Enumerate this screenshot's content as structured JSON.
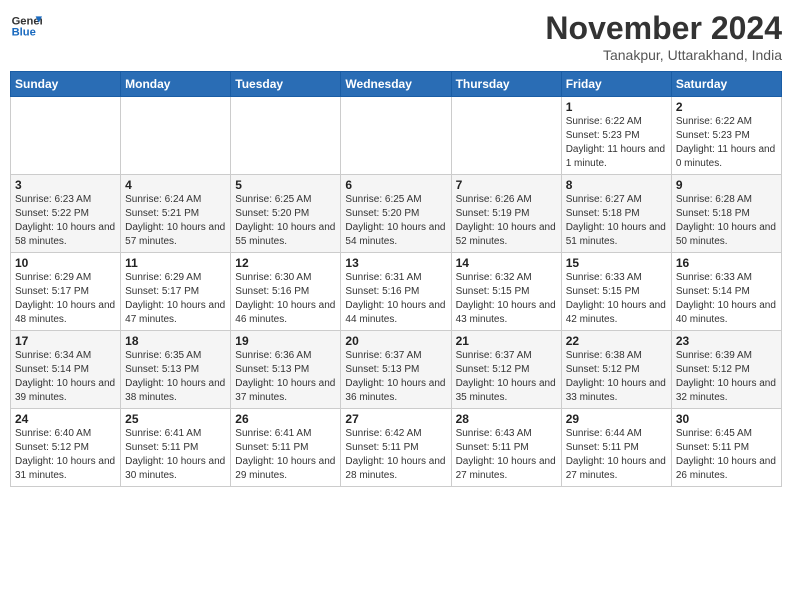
{
  "logo": {
    "line1": "General",
    "line2": "Blue"
  },
  "title": "November 2024",
  "location": "Tanakpur, Uttarakhand, India",
  "days_of_week": [
    "Sunday",
    "Monday",
    "Tuesday",
    "Wednesday",
    "Thursday",
    "Friday",
    "Saturday"
  ],
  "weeks": [
    [
      {
        "day": "",
        "info": ""
      },
      {
        "day": "",
        "info": ""
      },
      {
        "day": "",
        "info": ""
      },
      {
        "day": "",
        "info": ""
      },
      {
        "day": "",
        "info": ""
      },
      {
        "day": "1",
        "info": "Sunrise: 6:22 AM\nSunset: 5:23 PM\nDaylight: 11 hours and 1 minute."
      },
      {
        "day": "2",
        "info": "Sunrise: 6:22 AM\nSunset: 5:23 PM\nDaylight: 11 hours and 0 minutes."
      }
    ],
    [
      {
        "day": "3",
        "info": "Sunrise: 6:23 AM\nSunset: 5:22 PM\nDaylight: 10 hours and 58 minutes."
      },
      {
        "day": "4",
        "info": "Sunrise: 6:24 AM\nSunset: 5:21 PM\nDaylight: 10 hours and 57 minutes."
      },
      {
        "day": "5",
        "info": "Sunrise: 6:25 AM\nSunset: 5:20 PM\nDaylight: 10 hours and 55 minutes."
      },
      {
        "day": "6",
        "info": "Sunrise: 6:25 AM\nSunset: 5:20 PM\nDaylight: 10 hours and 54 minutes."
      },
      {
        "day": "7",
        "info": "Sunrise: 6:26 AM\nSunset: 5:19 PM\nDaylight: 10 hours and 52 minutes."
      },
      {
        "day": "8",
        "info": "Sunrise: 6:27 AM\nSunset: 5:18 PM\nDaylight: 10 hours and 51 minutes."
      },
      {
        "day": "9",
        "info": "Sunrise: 6:28 AM\nSunset: 5:18 PM\nDaylight: 10 hours and 50 minutes."
      }
    ],
    [
      {
        "day": "10",
        "info": "Sunrise: 6:29 AM\nSunset: 5:17 PM\nDaylight: 10 hours and 48 minutes."
      },
      {
        "day": "11",
        "info": "Sunrise: 6:29 AM\nSunset: 5:17 PM\nDaylight: 10 hours and 47 minutes."
      },
      {
        "day": "12",
        "info": "Sunrise: 6:30 AM\nSunset: 5:16 PM\nDaylight: 10 hours and 46 minutes."
      },
      {
        "day": "13",
        "info": "Sunrise: 6:31 AM\nSunset: 5:16 PM\nDaylight: 10 hours and 44 minutes."
      },
      {
        "day": "14",
        "info": "Sunrise: 6:32 AM\nSunset: 5:15 PM\nDaylight: 10 hours and 43 minutes."
      },
      {
        "day": "15",
        "info": "Sunrise: 6:33 AM\nSunset: 5:15 PM\nDaylight: 10 hours and 42 minutes."
      },
      {
        "day": "16",
        "info": "Sunrise: 6:33 AM\nSunset: 5:14 PM\nDaylight: 10 hours and 40 minutes."
      }
    ],
    [
      {
        "day": "17",
        "info": "Sunrise: 6:34 AM\nSunset: 5:14 PM\nDaylight: 10 hours and 39 minutes."
      },
      {
        "day": "18",
        "info": "Sunrise: 6:35 AM\nSunset: 5:13 PM\nDaylight: 10 hours and 38 minutes."
      },
      {
        "day": "19",
        "info": "Sunrise: 6:36 AM\nSunset: 5:13 PM\nDaylight: 10 hours and 37 minutes."
      },
      {
        "day": "20",
        "info": "Sunrise: 6:37 AM\nSunset: 5:13 PM\nDaylight: 10 hours and 36 minutes."
      },
      {
        "day": "21",
        "info": "Sunrise: 6:37 AM\nSunset: 5:12 PM\nDaylight: 10 hours and 35 minutes."
      },
      {
        "day": "22",
        "info": "Sunrise: 6:38 AM\nSunset: 5:12 PM\nDaylight: 10 hours and 33 minutes."
      },
      {
        "day": "23",
        "info": "Sunrise: 6:39 AM\nSunset: 5:12 PM\nDaylight: 10 hours and 32 minutes."
      }
    ],
    [
      {
        "day": "24",
        "info": "Sunrise: 6:40 AM\nSunset: 5:12 PM\nDaylight: 10 hours and 31 minutes."
      },
      {
        "day": "25",
        "info": "Sunrise: 6:41 AM\nSunset: 5:11 PM\nDaylight: 10 hours and 30 minutes."
      },
      {
        "day": "26",
        "info": "Sunrise: 6:41 AM\nSunset: 5:11 PM\nDaylight: 10 hours and 29 minutes."
      },
      {
        "day": "27",
        "info": "Sunrise: 6:42 AM\nSunset: 5:11 PM\nDaylight: 10 hours and 28 minutes."
      },
      {
        "day": "28",
        "info": "Sunrise: 6:43 AM\nSunset: 5:11 PM\nDaylight: 10 hours and 27 minutes."
      },
      {
        "day": "29",
        "info": "Sunrise: 6:44 AM\nSunset: 5:11 PM\nDaylight: 10 hours and 27 minutes."
      },
      {
        "day": "30",
        "info": "Sunrise: 6:45 AM\nSunset: 5:11 PM\nDaylight: 10 hours and 26 minutes."
      }
    ]
  ]
}
